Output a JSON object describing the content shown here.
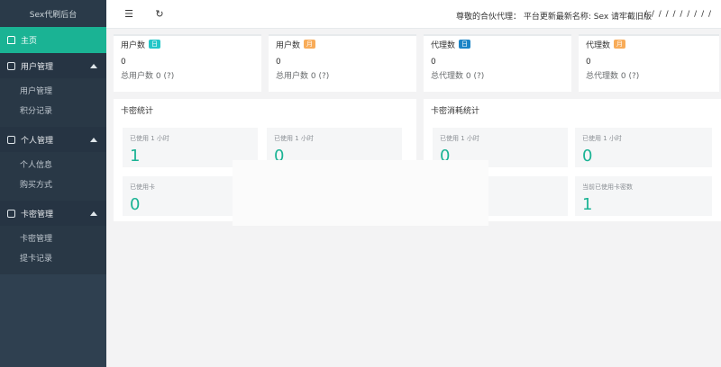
{
  "brand": "Sex代刷后台",
  "nav": {
    "home": "主页",
    "groups": [
      {
        "label": "用户管理",
        "items": [
          "用户管理",
          "积分记录"
        ]
      },
      {
        "label": "个人管理",
        "items": [
          "个人信息",
          "购买方式"
        ]
      },
      {
        "label": "卡密管理",
        "items": [
          "卡密管理",
          "提卡记录"
        ]
      }
    ]
  },
  "topbar": {
    "notice": "尊敬的合伙代理：  平台更新最新名称: Sex 请牢截旧版",
    "right": "/ / / / / / / / / /"
  },
  "stats": [
    {
      "title": "用户数",
      "badge": "日",
      "badge_color": "#23c6c8",
      "value": "0",
      "sub": "总用户数 0 (?)"
    },
    {
      "title": "用户数",
      "badge": "月",
      "badge_color": "#f8ac59",
      "value": "0",
      "sub": "总用户数 0 (?)"
    },
    {
      "title": "代理数",
      "badge": "日",
      "badge_color": "#1c84c6",
      "value": "0",
      "sub": "总代理数 0 (?)"
    },
    {
      "title": "代理数",
      "badge": "月",
      "badge_color": "#f8ac59",
      "value": "0",
      "sub": "总代理数 0 (?)"
    }
  ],
  "panels": {
    "left": {
      "title": "卡密统计",
      "tiles": [
        {
          "label": "已使用 1 小时",
          "value": "1"
        },
        {
          "label": "已使用 1 小时",
          "value": "0"
        },
        {
          "label": "已使用卡",
          "value": "0"
        },
        {
          "label": "",
          "value": ""
        }
      ]
    },
    "right": {
      "title": "卡密消耗统计",
      "tiles": [
        {
          "label": "已使用 1 小时",
          "value": "0"
        },
        {
          "label": "已使用 1 小时",
          "value": "0"
        },
        {
          "label": "",
          "value": ""
        },
        {
          "label": "当前已使用卡密数",
          "value": "1"
        }
      ]
    }
  }
}
